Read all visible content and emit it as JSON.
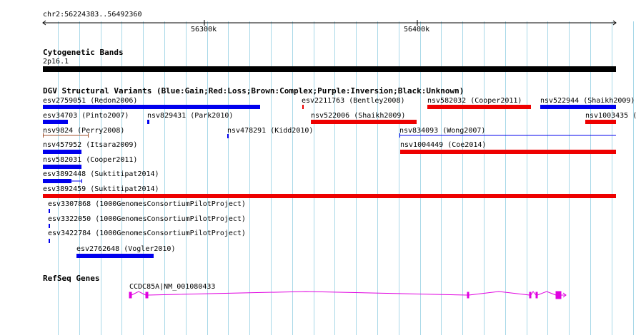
{
  "ruler": {
    "range_label": "chr2:56224383..56492360",
    "ticks": [
      "56300k",
      "56400k"
    ]
  },
  "cytoband": {
    "title": "Cytogenetic Bands",
    "band": "2p16.1"
  },
  "dgv": {
    "title": "DGV Structural Variants (Blue:Gain;Red:Loss;Brown:Complex;Purple:Inversion;Black:Unknown)",
    "features": [
      {
        "label": "esv2759051 (Redon2006)",
        "type": "gain"
      },
      {
        "label": "esv2211763 (Bentley2008)",
        "type": "loss"
      },
      {
        "label": "nsv582032 (Cooper2011)",
        "type": "loss"
      },
      {
        "label": "nsv522944 (Shaikh2009)",
        "type": "gain"
      },
      {
        "label": "esv34703 (Pinto2007)",
        "type": "gain"
      },
      {
        "label": "nsv829431 (Park2010)",
        "type": "gain"
      },
      {
        "label": "nsv522006 (Shaikh2009)",
        "type": "loss"
      },
      {
        "label": "nsv1003435 (",
        "type": "loss"
      },
      {
        "label": "nsv9824 (Perry2008)",
        "type": "complex"
      },
      {
        "label": "nsv478291 (Kidd2010)",
        "type": "gain"
      },
      {
        "label": "nsv834093 (Wong2007)",
        "type": "gain"
      },
      {
        "label": "nsv457952 (Itsara2009)",
        "type": "gain"
      },
      {
        "label": "nsv1004449 (Coe2014)",
        "type": "loss"
      },
      {
        "label": "nsv582031 (Cooper2011)",
        "type": "gain"
      },
      {
        "label": "esv3892448 (Suktitipat2014)",
        "type": "gain"
      },
      {
        "label": "esv3892459 (Suktitipat2014)",
        "type": "loss"
      },
      {
        "label": "esv3307868 (1000GenomesConsortiumPilotProject)",
        "type": "gain"
      },
      {
        "label": "esv3322050 (1000GenomesConsortiumPilotProject)",
        "type": "gain"
      },
      {
        "label": "esv3422784 (1000GenomesConsortiumPilotProject)",
        "type": "gain"
      },
      {
        "label": "esv2762648 (Vogler2010)",
        "type": "gain"
      }
    ]
  },
  "refseq": {
    "title": "RefSeq Genes",
    "gene_label": "CCDC85A|NM_001080433"
  },
  "colors": {
    "gain": "#0000ee",
    "loss": "#ee0000",
    "complex": "#a0522d",
    "gene": "#e000e0",
    "grid": "#a8d8e8",
    "band": "#000000"
  }
}
